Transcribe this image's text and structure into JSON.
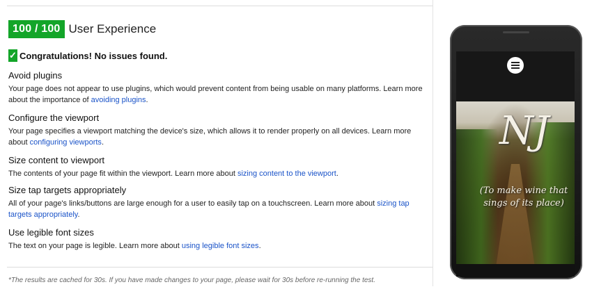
{
  "score": {
    "badge": "100 / 100",
    "title": "User Experience"
  },
  "congrats": {
    "check_glyph": "✓",
    "text": "Congratulations! No issues found."
  },
  "rules": [
    {
      "title": "Avoid plugins",
      "text1": "Your page does not appear to use plugins, which would prevent content from being usable on many platforms. Learn more about the importance of ",
      "link": "avoiding plugins",
      "text2": "."
    },
    {
      "title": "Configure the viewport",
      "text1": "Your page specifies a viewport matching the device's size, which allows it to render properly on all devices. Learn more about ",
      "link": "configuring viewports",
      "text2": "."
    },
    {
      "title": "Size content to viewport",
      "text1": "The contents of your page fit within the viewport. Learn more about ",
      "link": "sizing content to the viewport",
      "text2": "."
    },
    {
      "title": "Size tap targets appropriately",
      "text1": "All of your page's links/buttons are large enough for a user to easily tap on a touchscreen. Learn more about ",
      "link": "sizing tap targets appropriately",
      "text2": "."
    },
    {
      "title": "Use legible font sizes",
      "text1": "The text on your page is legible. Learn more about ",
      "link": "using legible font sizes",
      "text2": "."
    }
  ],
  "footnote": "*The results are cached for 30s. If you have made changes to your page, please wait for 30s before re-running the test.",
  "phone": {
    "monogram": "NJ",
    "tagline": "(To make wine that sings of its place)"
  },
  "colors": {
    "accent": "#13a529",
    "link": "#1a53c8"
  },
  "icons": [
    "check-icon",
    "hamburger-menu-icon"
  ]
}
